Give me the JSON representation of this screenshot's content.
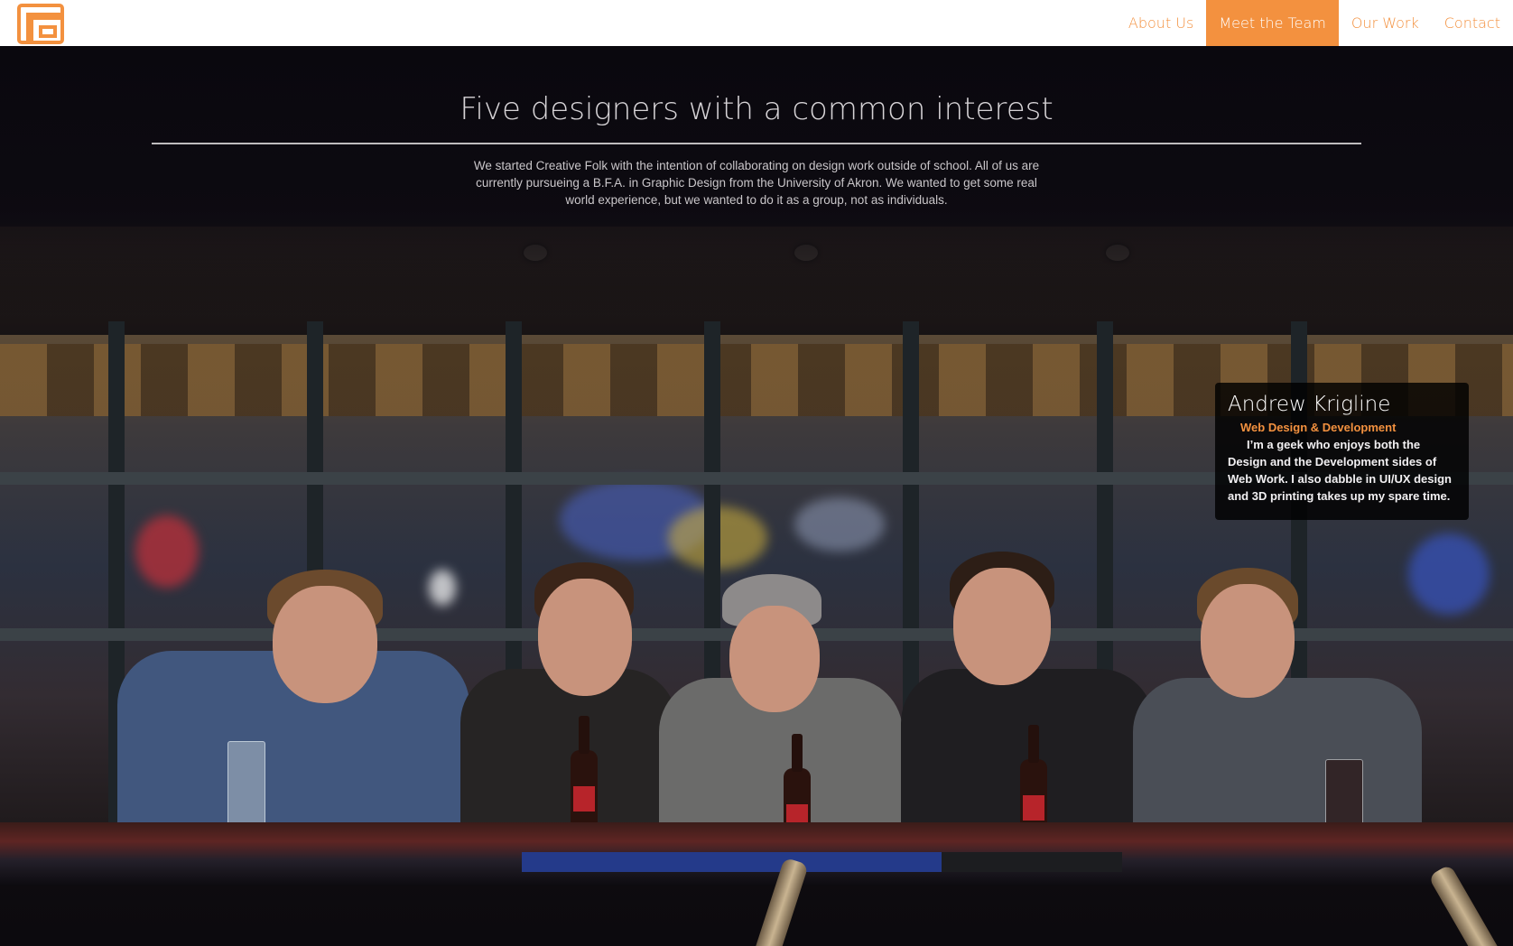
{
  "brand": {
    "logo_icon": "creative-folk-logo-icon",
    "accent": "#f3913f"
  },
  "nav": {
    "items": [
      {
        "label": "About Us",
        "active": false
      },
      {
        "label": "Meet the Team",
        "active": true
      },
      {
        "label": "Our Work",
        "active": false
      },
      {
        "label": "Contact",
        "active": false
      }
    ]
  },
  "hero": {
    "title": "Five designers with a common interest",
    "intro": "We started Creative Folk with the intention of collaborating on design work outside of school. All of us are currently pursueing a B.F.A. in Graphic Design from the University of Akron. We wanted to get some real world experience, but we wanted to do it as a group, not as individuals."
  },
  "member_card": {
    "name": "Andrew Krigline",
    "role": "Web Design & Development",
    "bio": "I’m a geek who enjoys both the Design and the Development sides of Web Work. I also dabble in UI/UX design and 3D printing takes up my spare time."
  }
}
